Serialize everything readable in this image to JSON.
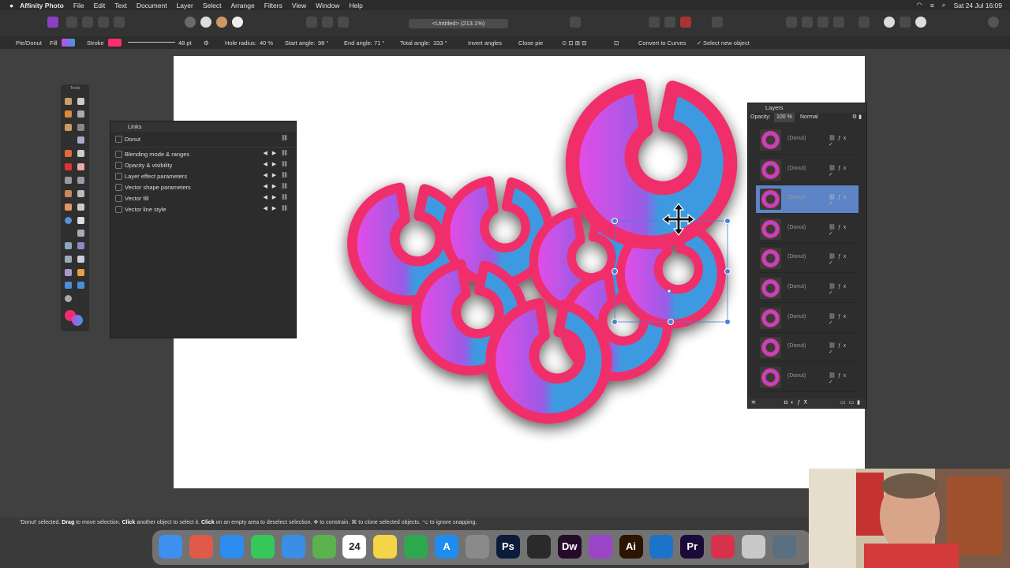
{
  "menubar": {
    "app_name": "Affinity Photo",
    "items": [
      "File",
      "Edit",
      "Text",
      "Document",
      "Layer",
      "Select",
      "Arrange",
      "Filters",
      "View",
      "Window",
      "Help"
    ],
    "clock": "Sat 24 Jul 16:09"
  },
  "toolbar": {
    "document_title": "<Untitled> (213.1%)"
  },
  "context": {
    "tool_name": "Pie/Donut",
    "fill_label": "Fill",
    "stroke_label": "Stroke",
    "stroke_width": "48 pt",
    "hole_radius_label": "Hole radius:",
    "hole_radius_value": "40 %",
    "start_angle_label": "Start angle:",
    "start_angle_value": "98 °",
    "end_angle_label": "End angle:",
    "end_angle_value": "71 °",
    "total_angle_label": "Total angle:",
    "total_angle_value": "333 °",
    "invert_angles": "Invert angles",
    "close_pie": "Close pie",
    "convert_to_curves": "Convert to Curves",
    "select_new_object": "Select new object"
  },
  "tools_panel": {
    "title": "Tools"
  },
  "links_panel": {
    "title": "Links",
    "object": "Donut",
    "rows": [
      "Blending mode & ranges",
      "Opacity & visibility",
      "Layer effect parameters",
      "Vector shape parameters",
      "Vector fill",
      "Vector line style"
    ]
  },
  "layers_panel": {
    "title": "Layers",
    "opacity_label": "Opacity:",
    "opacity_value": "100 %",
    "blend_mode": "Normal",
    "layers": [
      "(Donut)",
      "(Donut)",
      "(Donut)",
      "(Donut)",
      "(Donut)",
      "(Donut)",
      "(Donut)",
      "(Donut)",
      "(Donut)"
    ],
    "selected_index": 2
  },
  "status": {
    "text_1": "'Donut' selected.",
    "drag": "Drag",
    "text_2": "to move selection.",
    "click1": "Click",
    "text_3": "another object to select it.",
    "click2": "Click",
    "text_4": "on an empty area to deselect selection. ✥ to constrain. ⌘ to clone selected objects. ⌥ to ignore snapping."
  },
  "dock": {
    "apps": [
      {
        "name": "finder",
        "label": "",
        "color": "#3d8ff0"
      },
      {
        "name": "launchpad",
        "label": "",
        "color": "#e05a4a"
      },
      {
        "name": "safari",
        "label": "",
        "color": "#2d8cf0"
      },
      {
        "name": "messages",
        "label": "",
        "color": "#35c759"
      },
      {
        "name": "mail",
        "label": "",
        "color": "#3a8ee6"
      },
      {
        "name": "maps",
        "label": "",
        "color": "#5ab34f"
      },
      {
        "name": "calendar",
        "label": "24",
        "color": "#ffffff"
      },
      {
        "name": "notes",
        "label": "",
        "color": "#f5d547"
      },
      {
        "name": "numbers",
        "label": "",
        "color": "#2ea84f"
      },
      {
        "name": "app-store",
        "label": "A",
        "color": "#1e8cf0"
      },
      {
        "name": "system-preferences",
        "label": "",
        "color": "#8a8a8a"
      },
      {
        "name": "photoshop",
        "label": "Ps",
        "color": "#0b1c3a"
      },
      {
        "name": "obs",
        "label": "",
        "color": "#2a2a2a"
      },
      {
        "name": "dreamweaver",
        "label": "Dw",
        "color": "#260a2a"
      },
      {
        "name": "affinity-photo",
        "label": "",
        "color": "#9b45c9"
      },
      {
        "name": "illustrator",
        "label": "Ai",
        "color": "#2b1400"
      },
      {
        "name": "affinity-designer",
        "label": "",
        "color": "#1b74c9"
      },
      {
        "name": "premiere",
        "label": "Pr",
        "color": "#1a0a3a"
      },
      {
        "name": "creative-cloud",
        "label": "",
        "color": "#d8324a"
      },
      {
        "name": "preview",
        "label": "",
        "color": "#c8c8c8"
      },
      {
        "name": "screenshot",
        "label": "",
        "color": "#5a6f80"
      }
    ]
  },
  "colors": {
    "pink": "#ff2d6d",
    "blue": "#3d9ae0",
    "purple": "#c44ae8",
    "selection": "#4a7fd6"
  }
}
